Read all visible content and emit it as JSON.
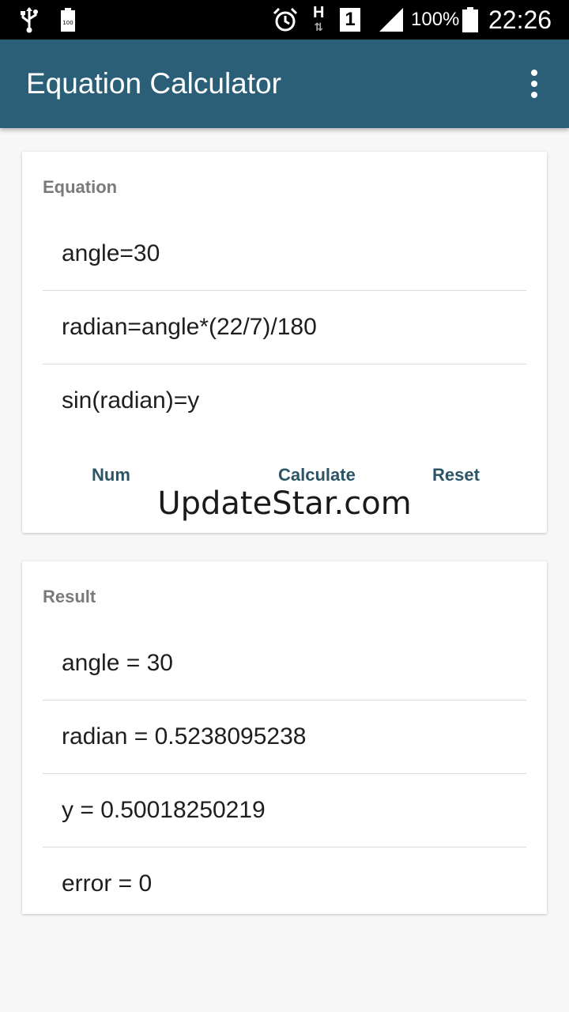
{
  "status_bar": {
    "battery_percent": "100%",
    "time": "22:26",
    "network_type": "H",
    "sim_slot": "1",
    "icons": [
      "usb-icon",
      "battery-small-icon",
      "alarm-icon",
      "signal-icon",
      "battery-icon"
    ]
  },
  "app_bar": {
    "title": "Equation Calculator",
    "overflow_icon": "more-vert-icon",
    "color": "#2b5f78"
  },
  "equation_card": {
    "label": "Equation",
    "lines": [
      "angle=30",
      "radian=angle*(22/7)/180",
      "sin(radian)=y"
    ],
    "buttons": {
      "num": "Num",
      "calculate": "Calculate",
      "reset": "Reset"
    },
    "watermark": "UpdateStar.com"
  },
  "result_card": {
    "label": "Result",
    "lines": [
      "angle = 30",
      "radian = 0.5238095238",
      "y = 0.50018250219",
      "error = 0"
    ]
  }
}
